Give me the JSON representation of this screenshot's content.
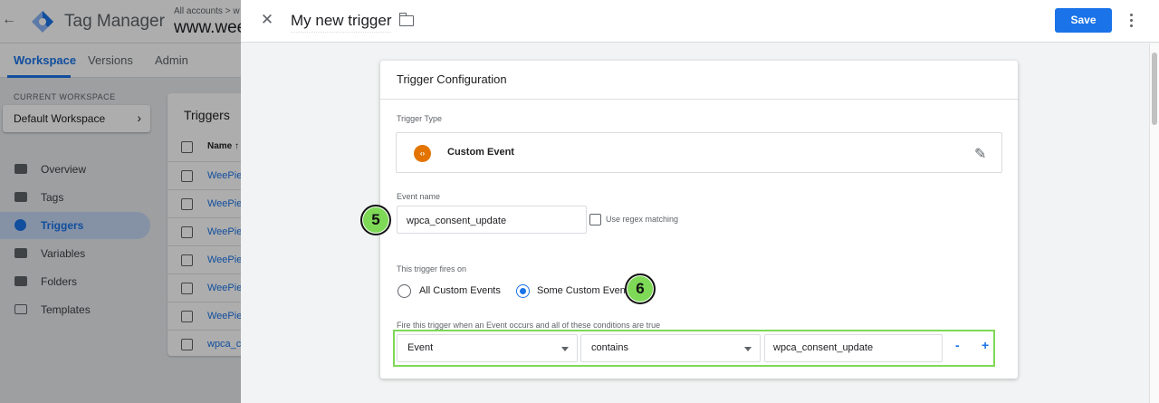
{
  "app": {
    "title": "Tag Manager",
    "breadcrumb": "All accounts > w",
    "container_name": "www.wee"
  },
  "main_tabs": [
    {
      "label": "Workspace",
      "active": true
    },
    {
      "label": "Versions",
      "active": false
    },
    {
      "label": "Admin",
      "active": false
    }
  ],
  "sidebar": {
    "workspace_label": "CURRENT WORKSPACE",
    "workspace_name": "Default Workspace",
    "items": [
      {
        "label": "Overview",
        "icon": "briefcase-icon",
        "active": false
      },
      {
        "label": "Tags",
        "icon": "tag-icon",
        "active": false
      },
      {
        "label": "Triggers",
        "icon": "trigger-icon",
        "active": true
      },
      {
        "label": "Variables",
        "icon": "variables-icon",
        "active": false
      },
      {
        "label": "Folders",
        "icon": "folder-icon",
        "active": false
      },
      {
        "label": "Templates",
        "icon": "template-icon",
        "active": false
      }
    ]
  },
  "triggers_list": {
    "title": "Triggers",
    "header": "Name ↑",
    "rows": [
      "WeePie",
      "WeePie",
      "WeePie",
      "WeePie",
      "WeePie",
      "WeePie",
      "wpca_c"
    ]
  },
  "sheet": {
    "trigger_name": "My new trigger",
    "save_label": "Save"
  },
  "config": {
    "title": "Trigger Configuration",
    "trigger_type_label": "Trigger Type",
    "trigger_type": "Custom Event",
    "trigger_type_icon_glyph": "‹›",
    "event_name_label": "Event name",
    "event_name_value": "wpca_consent_update",
    "regex_label": "Use regex matching",
    "fires_on_label": "This trigger fires on",
    "fires_on_options": [
      {
        "label": "All Custom Events",
        "selected": false
      },
      {
        "label": "Some Custom Events",
        "selected": true
      }
    ],
    "condition_label": "Fire this trigger when an Event occurs and all of these conditions are true",
    "condition": {
      "variable": "Event",
      "operator": "contains",
      "value": "wpca_consent_update",
      "remove_label": "-",
      "add_label": "+"
    }
  },
  "annotations": {
    "step_5": "5",
    "step_6": "6"
  },
  "colors": {
    "accent": "#1a73e8",
    "highlight": "#7ed957",
    "custom_event_icon": "#e37400"
  }
}
